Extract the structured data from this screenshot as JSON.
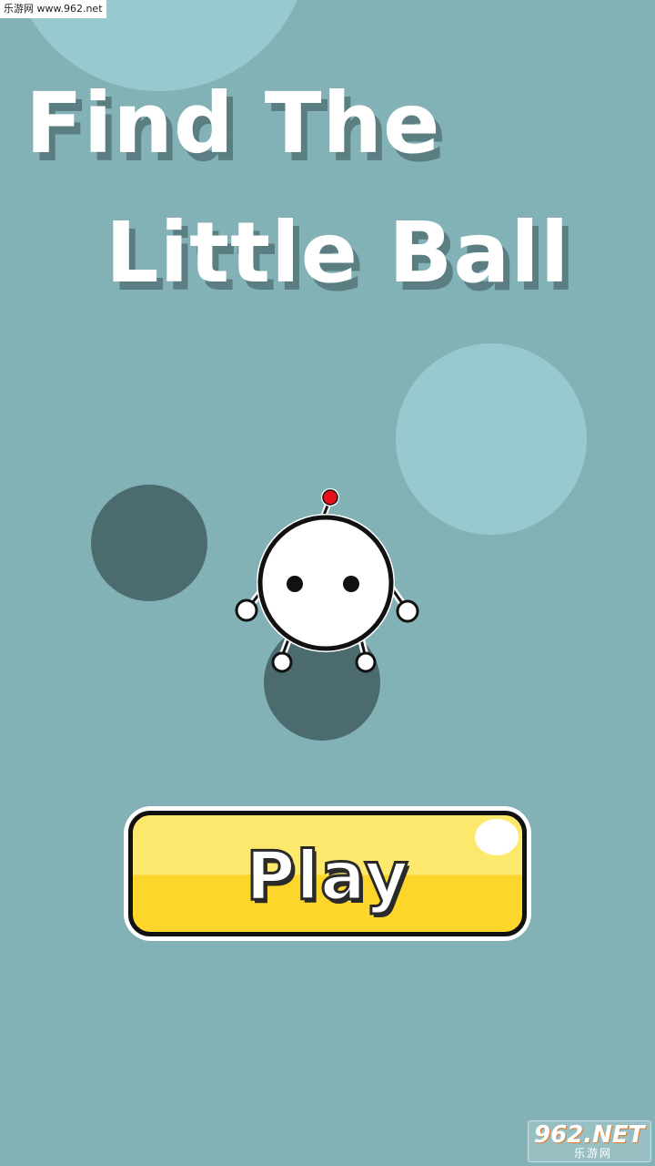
{
  "watermark_top": {
    "text": "乐游网 www.962.net"
  },
  "title": {
    "line1": "Find The",
    "line2": "Little Ball"
  },
  "play_button": {
    "label": "Play"
  },
  "watermark_bottom": {
    "logo": "962.NET",
    "sub": "乐游网"
  },
  "colors": {
    "background": "#82b2b6",
    "circle_light": "#98c9cf",
    "circle_dark": "#4b6b6e",
    "button_top": "#fde86e",
    "button_bottom": "#fcd62a",
    "antenna_tip": "#e8101a"
  }
}
